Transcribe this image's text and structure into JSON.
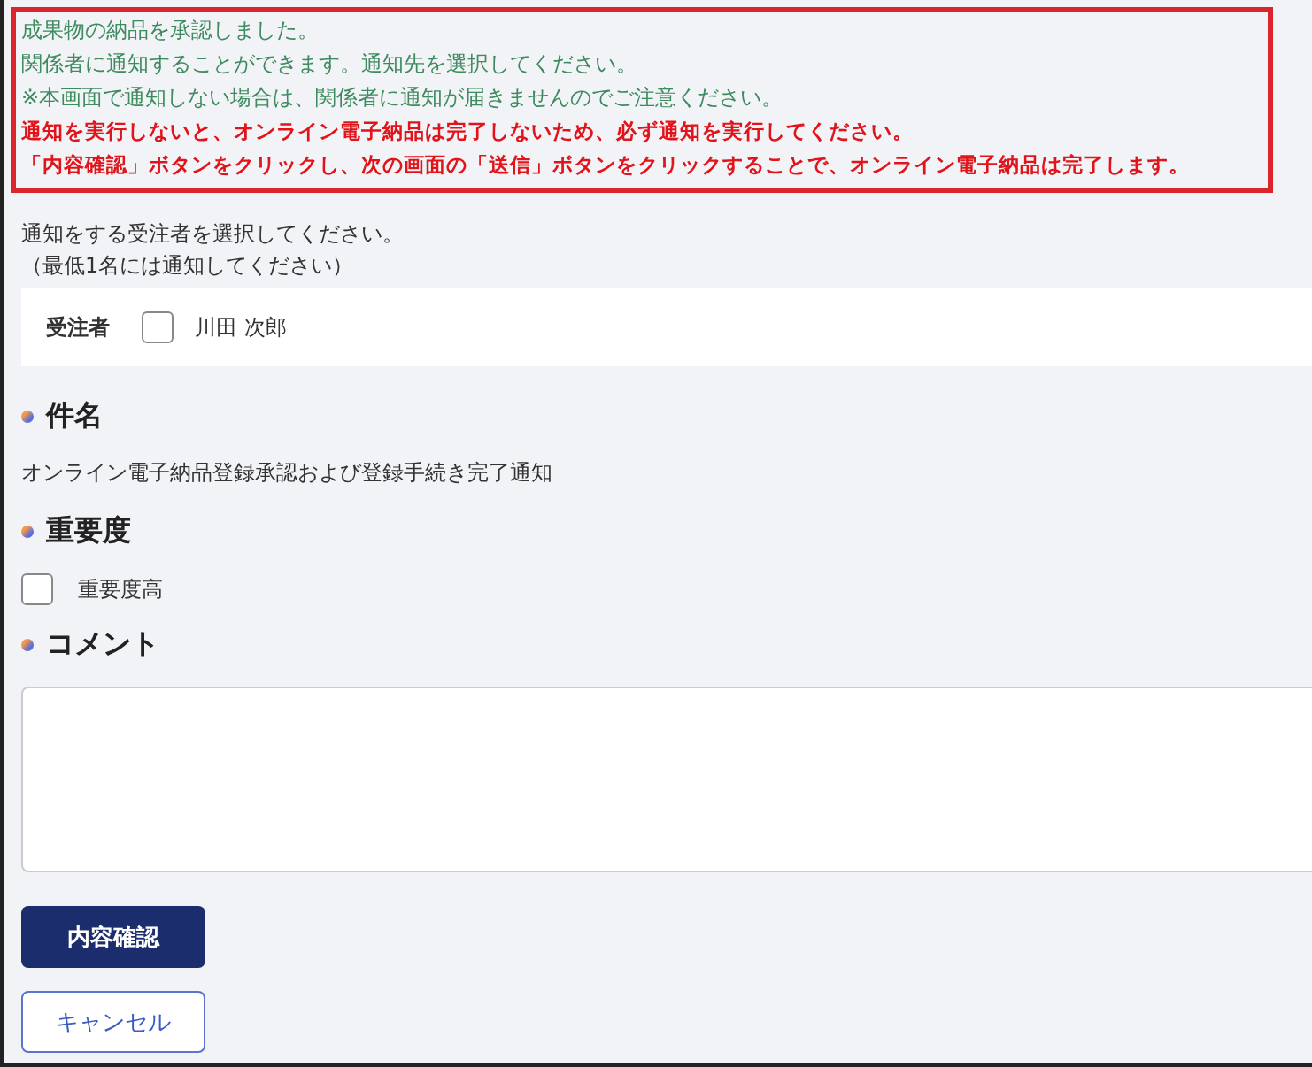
{
  "notice": {
    "messages": [
      {
        "kind": "info",
        "text": "成果物の納品を承認しました。"
      },
      {
        "kind": "info",
        "text": "関係者に通知することができます。通知先を選択してください。"
      },
      {
        "kind": "info",
        "text": "※本画面で通知しない場合は、関係者に通知が届きませんのでご注意ください。"
      },
      {
        "kind": "warning",
        "text": "通知を実行しないと、オンライン電子納品は完了しないため、必ず通知を実行してください。"
      },
      {
        "kind": "warning",
        "text": "「内容確認」ボタンをクリックし、次の画面の「送信」ボタンをクリックすることで、オンライン電子納品は完了します。"
      }
    ]
  },
  "recipients": {
    "instruction": "通知をする受注者を選択してください。",
    "note": "（最低1名には通知してください）",
    "label": "受注者",
    "items": [
      {
        "name": "川田 次郎",
        "checked": false
      }
    ]
  },
  "subject": {
    "heading": "件名",
    "value": "オンライン電子納品登録承認および登録手続き完了通知"
  },
  "importance": {
    "heading": "重要度",
    "option": {
      "label": "重要度高",
      "checked": false
    }
  },
  "comment": {
    "heading": "コメント"
  },
  "buttons": [
    {
      "kind": "primary",
      "label": "内容確認"
    },
    {
      "kind": "secondary",
      "label": "キャンセル"
    }
  ]
}
